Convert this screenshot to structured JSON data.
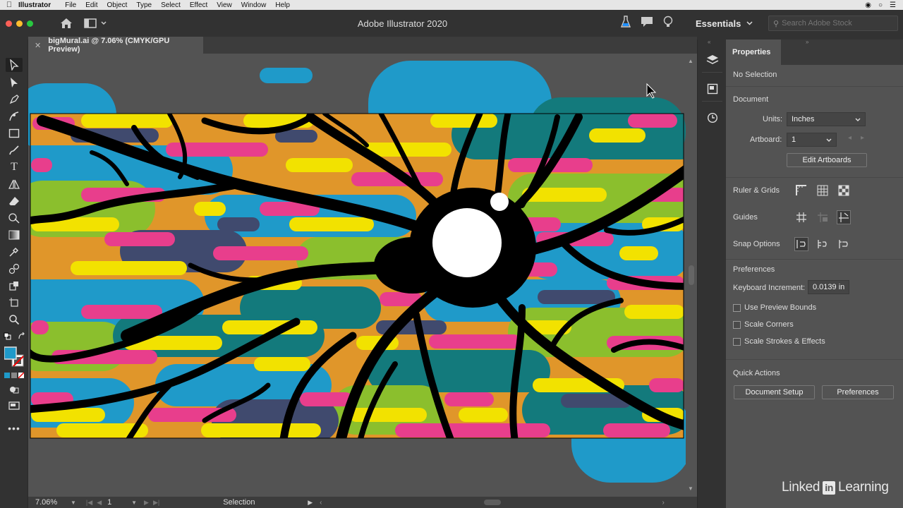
{
  "os_menu": {
    "app_name": "Illustrator",
    "items": [
      "File",
      "Edit",
      "Object",
      "Type",
      "Select",
      "Effect",
      "View",
      "Window",
      "Help"
    ]
  },
  "app": {
    "title": "Adobe Illustrator 2020",
    "workspace": "Essentials",
    "stock_placeholder": "Search Adobe Stock"
  },
  "document": {
    "tab_title": "bigMural.ai @ 7.06% (CMYK/GPU Preview)"
  },
  "status": {
    "zoom": "7.06%",
    "artboard": "1",
    "tool": "Selection"
  },
  "properties": {
    "tab": "Properties",
    "no_selection": "No Selection",
    "document_heading": "Document",
    "units_label": "Units:",
    "units_value": "Inches",
    "artboard_label": "Artboard:",
    "artboard_value": "1",
    "edit_artboards": "Edit Artboards",
    "ruler_grids": "Ruler & Grids",
    "guides": "Guides",
    "snap_options": "Snap Options",
    "preferences_heading": "Preferences",
    "keyboard_increment_label": "Keyboard Increment:",
    "keyboard_increment_value": "0.0139 in",
    "use_preview_bounds": "Use Preview Bounds",
    "scale_corners": "Scale Corners",
    "scale_strokes": "Scale Strokes & Effects",
    "quick_actions": "Quick Actions",
    "document_setup": "Document Setup",
    "preferences_button": "Preferences"
  },
  "watermark": {
    "left": "Linked",
    "in": "in",
    "right": "Learning"
  },
  "colors": {
    "blue": "#1f9ac9",
    "yellow": "#f2e200",
    "pink": "#e83e8c",
    "orange": "#e0962a",
    "green": "#8bbf2d",
    "teal": "#137a7c",
    "navy": "#404a6e"
  }
}
